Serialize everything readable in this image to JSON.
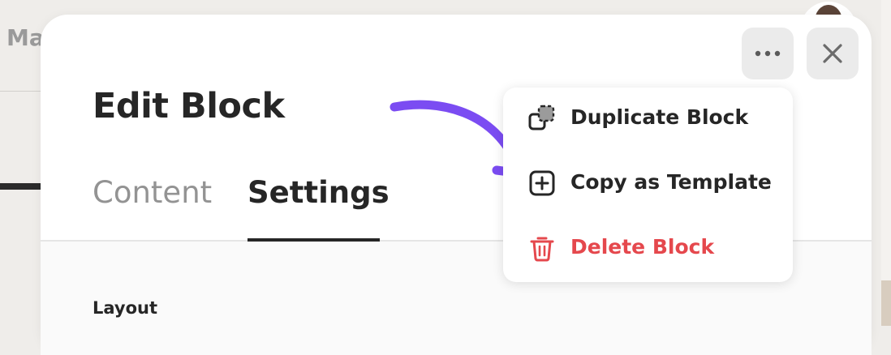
{
  "background": {
    "partial_label": "Ma"
  },
  "modal": {
    "title": "Edit Block",
    "tabs": [
      {
        "label": "Content",
        "active": false
      },
      {
        "label": "Settings",
        "active": true
      }
    ],
    "section_label": "Layout",
    "more_button_icon": "more-horizontal-icon",
    "close_button_icon": "close-icon"
  },
  "menu": {
    "items": [
      {
        "label": "Duplicate Block",
        "icon": "duplicate-icon",
        "color": "#262626"
      },
      {
        "label": "Copy as Template",
        "icon": "plus-square-icon",
        "color": "#262626"
      },
      {
        "label": "Delete Block",
        "icon": "trash-icon",
        "color": "#e5484d"
      }
    ]
  },
  "annotation": {
    "arrow_color": "#7b4cf2"
  }
}
